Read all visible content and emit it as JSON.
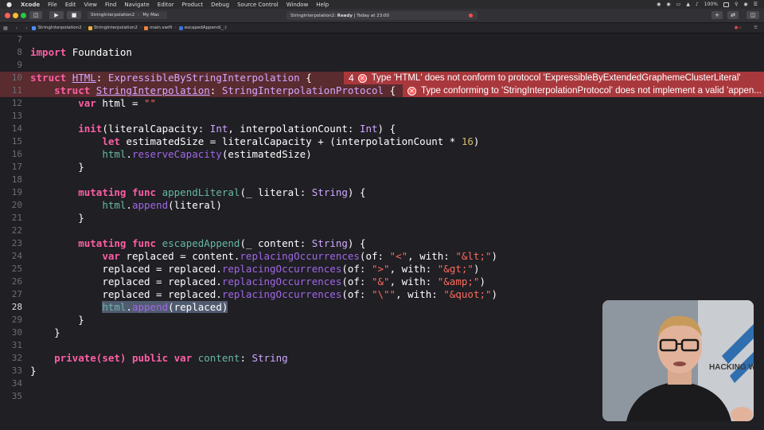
{
  "menubar": {
    "items": [
      "Xcode",
      "File",
      "Edit",
      "View",
      "Find",
      "Navigate",
      "Editor",
      "Product",
      "Debug",
      "Source Control",
      "Window",
      "Help"
    ],
    "battery": "100%"
  },
  "toolbar": {
    "scheme": "StringInterpolation2",
    "destination": "My Mac",
    "activity_project": "StringInterpolation2:",
    "activity_status": "Ready",
    "activity_time": "| Today at 23:00",
    "error_count": "4"
  },
  "pathbar": {
    "crumbs": [
      "StringInterpolation2",
      "StringInterpolation2",
      "main.swift",
      "escapedAppend(_:)"
    ]
  },
  "editor": {
    "line_numbers": [
      "7",
      "8",
      "9",
      "10",
      "11",
      "12",
      "13",
      "14",
      "15",
      "16",
      "17",
      "18",
      "19",
      "20",
      "21",
      "22",
      "23",
      "24",
      "25",
      "26",
      "27",
      "28",
      "29",
      "30",
      "31",
      "32",
      "33",
      "34",
      "35"
    ],
    "error_lines": [
      "10",
      "11"
    ],
    "errors": [
      {
        "count": "4",
        "message": "Type 'HTML' does not conform to protocol 'ExpressibleByExtendedGraphemeClusterLiteral'"
      },
      {
        "count": "",
        "message": "Type conforming to 'StringInterpolationProtocol' does not implement a valid 'appen..."
      }
    ],
    "tokens": {
      "import": "import",
      "foundation": "Foundation",
      "struct": "struct",
      "html_type": "HTML",
      "colon": ": ",
      "expressible": "ExpressibleByStringInterpolation",
      "brace_open": " {",
      "string_interpolation": "StringInterpolation",
      "interp_protocol": "StringInterpolationProtocol",
      "var": "var",
      "html_var": "html",
      "eq": " = ",
      "empty_str": "\"\"",
      "init": "init",
      "init_params_1": "(literalCapacity: ",
      "int": "Int",
      "init_params_2": ", interpolationCount: ",
      "init_params_3": ") {",
      "let": "let",
      "estimated_decl": " estimatedSize = literalCapacity + (interpolationCount * ",
      "sixteen": "16",
      "close_paren": ")",
      "reserve_capacity": "reserveCapacity",
      "reserve_arg": "(estimatedSize)",
      "brace_close": "}",
      "mutating": "mutating",
      "func": "func",
      "append_literal": "appendLiteral",
      "append_literal_params": "(_ literal: ",
      "string_type": "String",
      "params_close": ") {",
      "append": "append",
      "append_literal_arg": "(literal)",
      "escaped_append": "escapedAppend",
      "escaped_params": "(_ content: ",
      "replaced_decl": " replaced = content.",
      "replacing": "replacingOccurrences",
      "replaced_assign": "replaced = replaced.",
      "of_label": "(of: ",
      "with_label": ", with: ",
      "lt": "\"<\"",
      "lt_ent": "\"&lt;\"",
      "gt": "\">\"",
      "gt_ent": "\"&gt;\"",
      "amp": "\"&\"",
      "amp_ent": "\"&amp;\"",
      "quot": "\"\\\"\"",
      "quot_ent": "\"&quot;\"",
      "dot": ".",
      "append_replaced_arg": "(replaced)",
      "private_set": "private(set)",
      "public": "public",
      "content_decl_var": "content",
      "content_colon": ": "
    }
  },
  "webcam": {
    "backdrop_text": "HACKING W"
  },
  "colors": {
    "editor_bg": "#1f1f24",
    "keyword": "#fc5fa3",
    "type": "#d0a8ff",
    "string": "#fc6a5d",
    "number": "#d0bf69",
    "project_identifier": "#67b7a4",
    "framework_identifier": "#a167e6",
    "error_bg": "#a9383d",
    "error_line_bg": "#5a2b2f",
    "selection": "#515b70"
  }
}
